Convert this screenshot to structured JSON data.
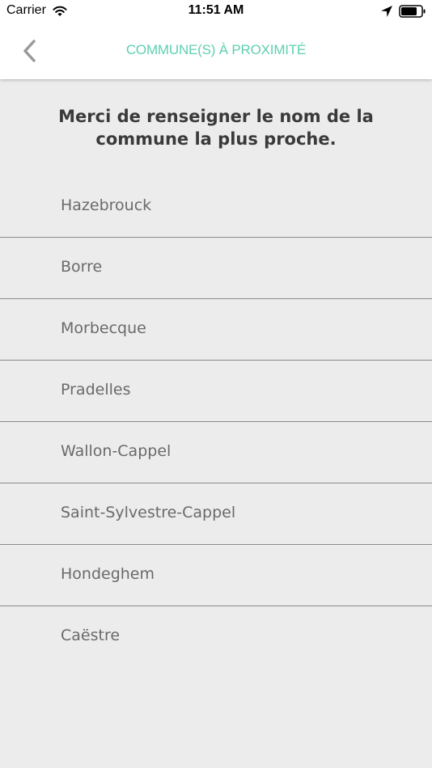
{
  "status_bar": {
    "carrier": "Carrier",
    "time": "11:51 AM",
    "icons": [
      "wifi-icon",
      "location-arrow-icon",
      "battery-icon"
    ]
  },
  "nav": {
    "title": "COMMUNE(S) À PROXIMITÉ",
    "back_icon": "chevron-left-icon"
  },
  "prompt": "Merci de renseigner le nom de la commune la plus proche.",
  "communes": [
    "Hazebrouck",
    "Borre",
    "Morbecque",
    "Pradelles",
    "Wallon-Cappel",
    "Saint-Sylvestre-Cappel",
    "Hondeghem",
    "Caëstre"
  ],
  "colors": {
    "accent": "#5ecfb0",
    "background": "#ececec",
    "text": "#3a3a3a",
    "item_text": "#6a6a6a"
  }
}
